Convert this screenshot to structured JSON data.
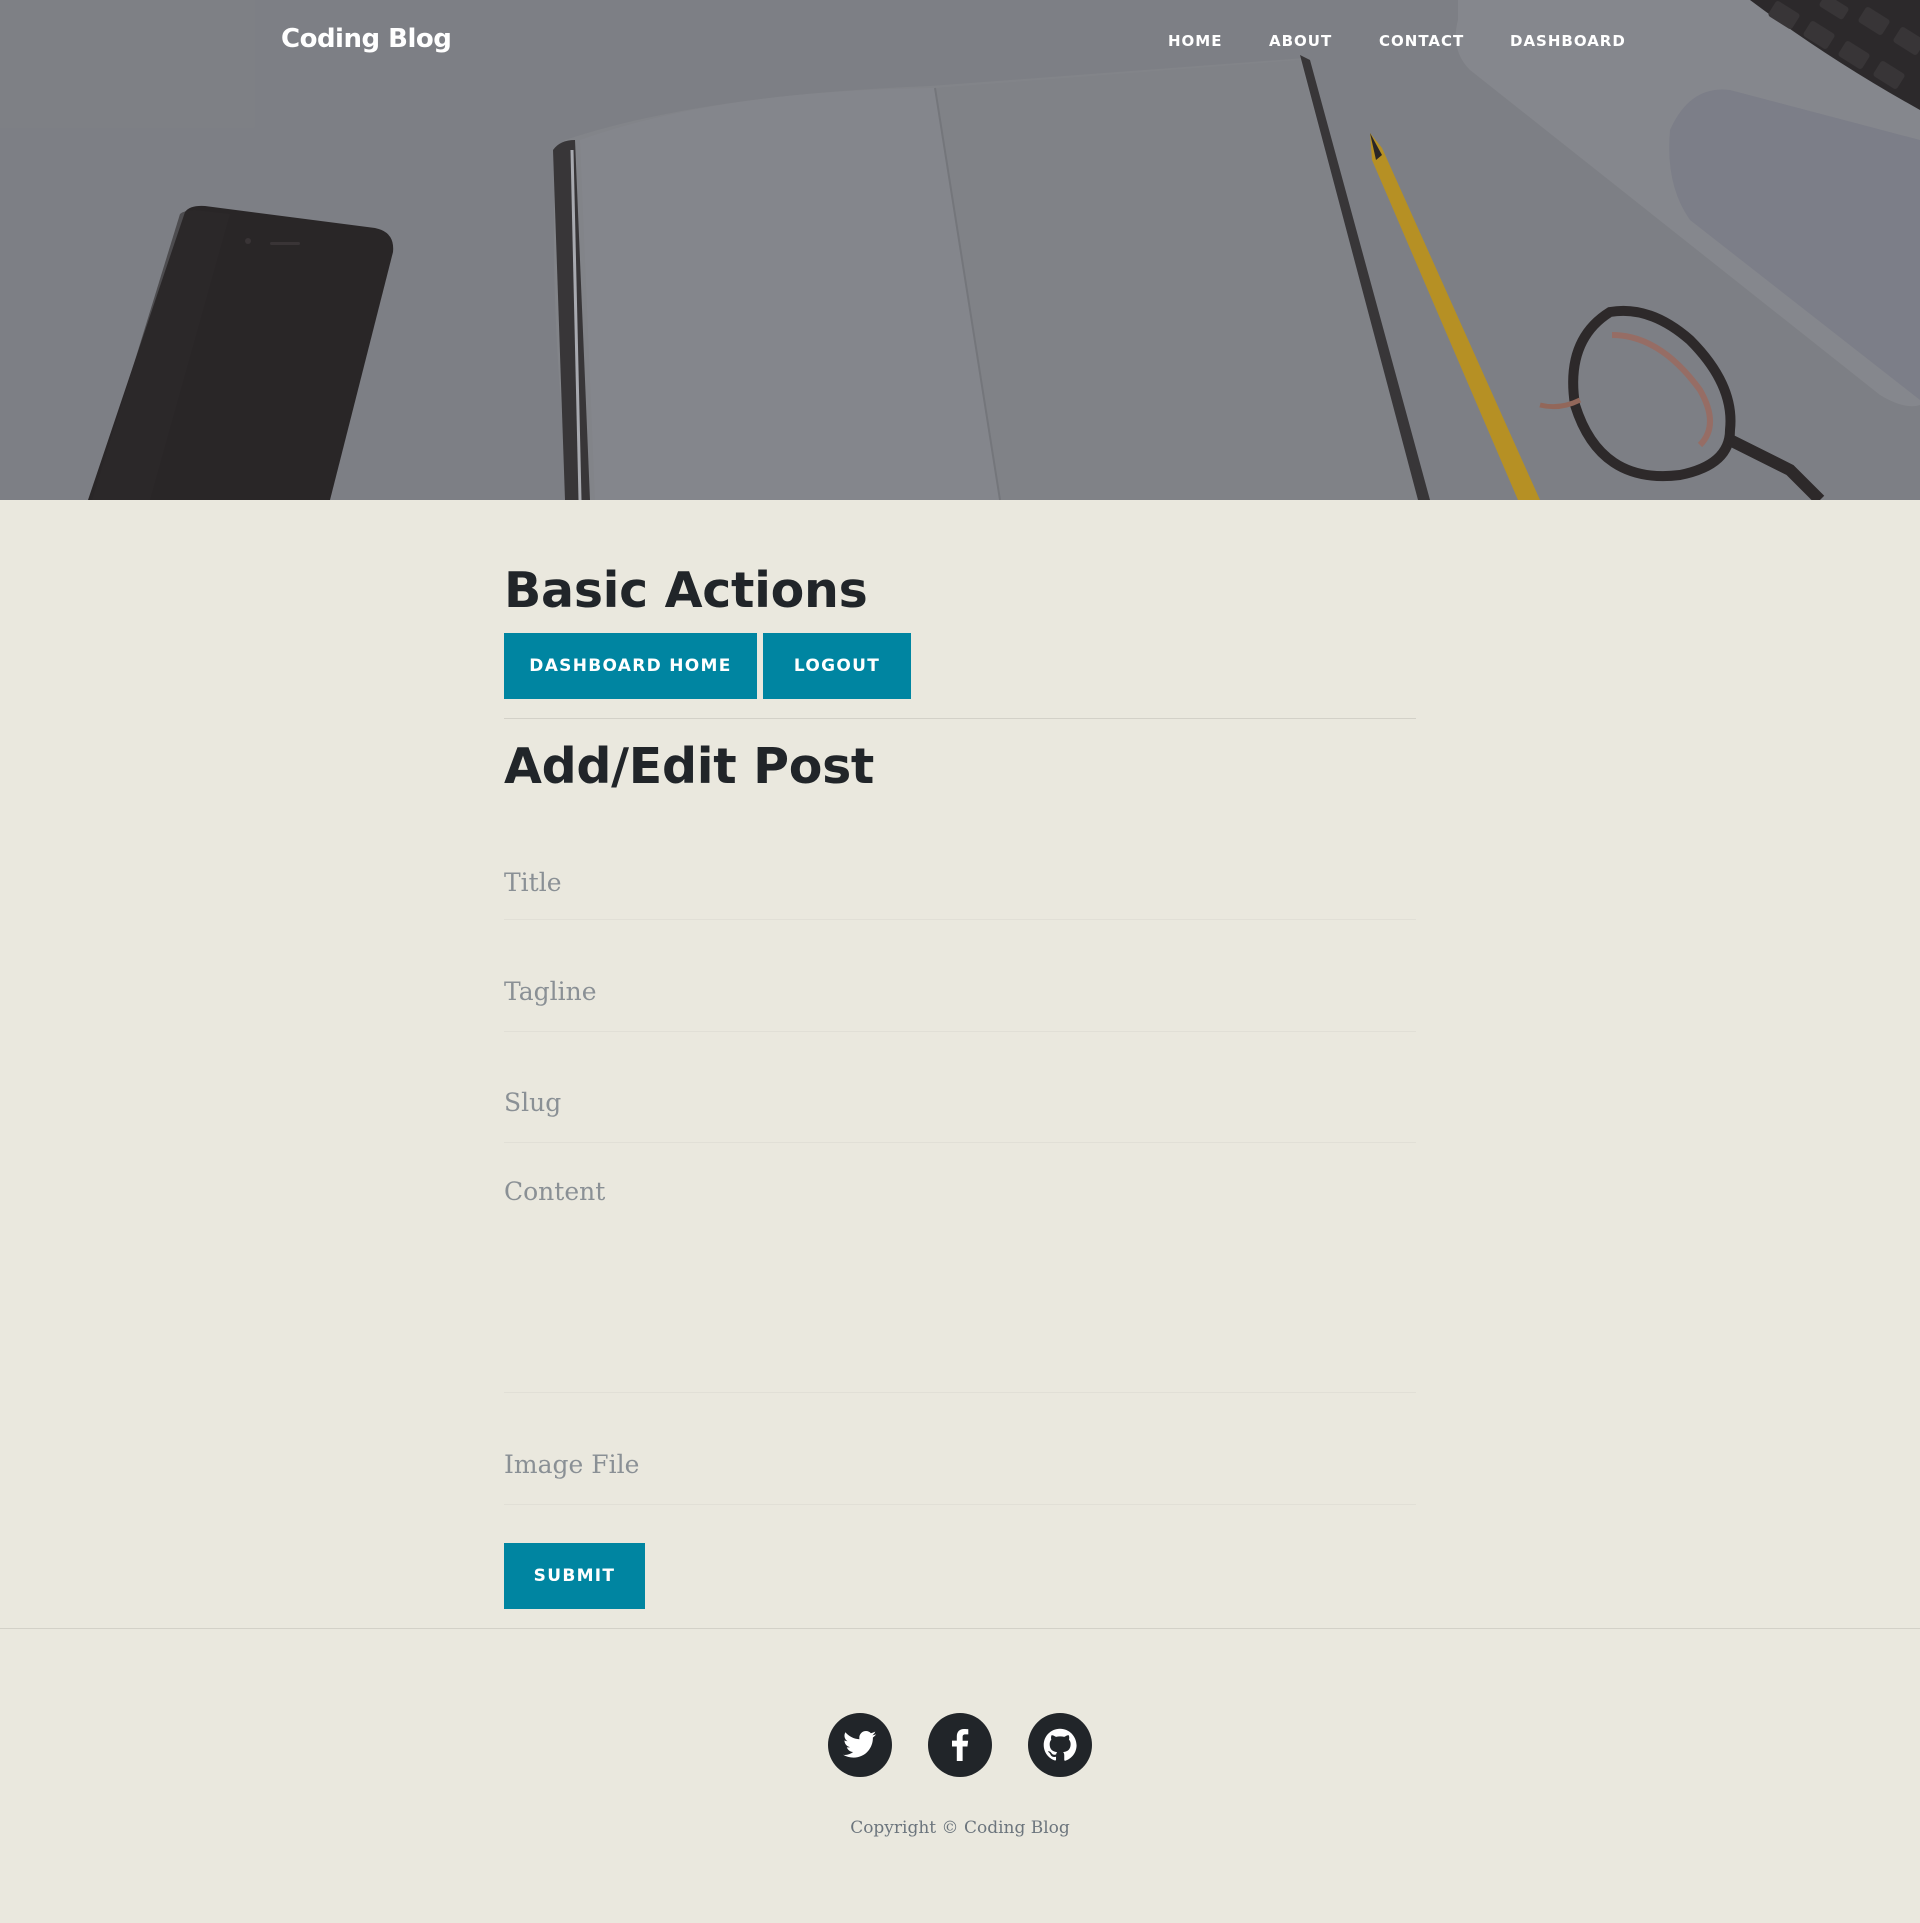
{
  "brand": "Coding Blog",
  "nav": {
    "home": "Home",
    "about": "About",
    "contact": "Contact",
    "dashboard": "Dashboard"
  },
  "basic_actions": {
    "heading": "Basic Actions",
    "dashboard_home": "Dashboard Home",
    "logout": "Logout"
  },
  "post_form": {
    "heading": "Add/Edit Post",
    "title_placeholder": "Title",
    "tagline_placeholder": "Tagline",
    "slug_placeholder": "Slug",
    "content_placeholder": "Content",
    "image_placeholder": "Image File",
    "submit": "Submit"
  },
  "footer": {
    "social_icons": [
      "twitter-icon",
      "facebook-icon",
      "github-icon"
    ],
    "copyright": "Copyright © Coding Blog"
  },
  "colors": {
    "accent": "#0085a1",
    "page_background": "#eae8de",
    "heading": "#212529"
  }
}
